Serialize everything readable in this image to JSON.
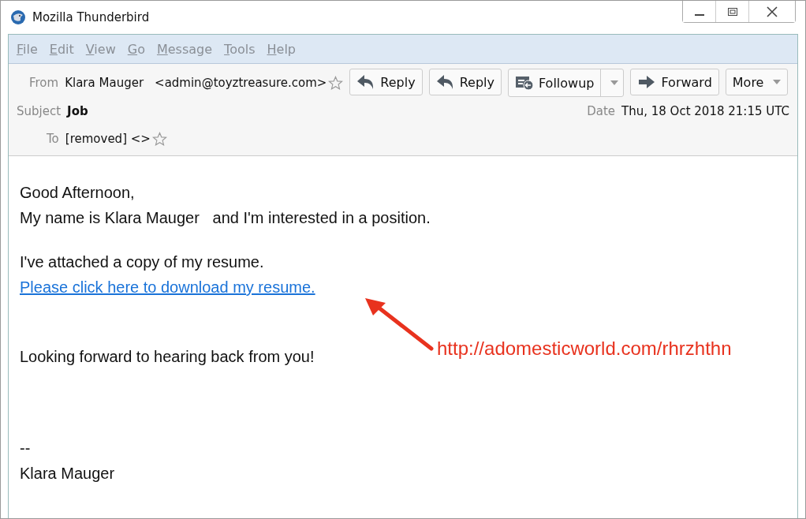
{
  "window": {
    "title": "Mozilla Thunderbird"
  },
  "menu": [
    "File",
    "Edit",
    "View",
    "Go",
    "Message",
    "Tools",
    "Help"
  ],
  "header": {
    "from_label": "From",
    "from_name": "Klara Mauger",
    "from_address": "<admin@toyztreasure.com>",
    "subject_label": "Subject",
    "subject": "Job",
    "date_label": "Date",
    "date": "Thu, 18 Oct 2018 21:15 UTC",
    "to_label": "To",
    "to": "[removed] <>"
  },
  "buttons": [
    {
      "kind": "reply",
      "label": "Reply"
    },
    {
      "kind": "reply",
      "label": "Reply"
    },
    {
      "kind": "followup",
      "label": "Followup"
    },
    {
      "kind": "forward",
      "label": "Forward"
    },
    {
      "kind": "more",
      "label": "More"
    }
  ],
  "body": {
    "paragraphs": [
      {
        "lines": [
          {
            "kind": "text",
            "text": "Good Afternoon,"
          },
          {
            "kind": "text",
            "text": "My name is Klara Mauger   and I'm interested in a position."
          }
        ]
      },
      {
        "lines": [
          {
            "kind": "text",
            "text": "I've attached a copy of my resume."
          },
          {
            "kind": "link",
            "text": "Please click here to download my resume."
          }
        ]
      },
      {
        "lines": [
          {
            "kind": "text",
            "text": "Looking forward to hearing back from you!"
          }
        ]
      },
      {
        "lines": [
          {
            "kind": "text",
            "text": "--"
          },
          {
            "kind": "text",
            "text": "Klara Mauger"
          }
        ]
      }
    ]
  },
  "annotation": {
    "text": "http://adomesticworld.com/rhrzhthn"
  }
}
